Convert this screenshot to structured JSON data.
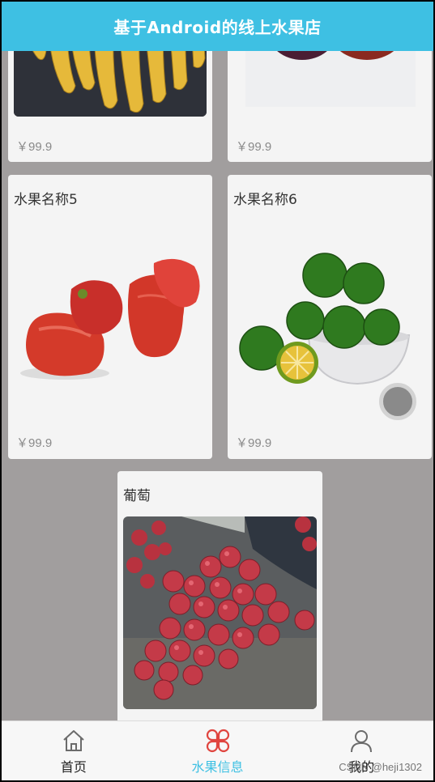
{
  "header": {
    "title": "基于Android的线上水果店"
  },
  "products": [
    {
      "name": "",
      "price": "￥99.9",
      "image": "bananas"
    },
    {
      "name": "",
      "price": "￥99.9",
      "image": "plums"
    },
    {
      "name": "水果名称5",
      "price": "￥99.9",
      "image": "wax-apples"
    },
    {
      "name": "水果名称6",
      "price": "￥99.9",
      "image": "limes"
    },
    {
      "name": "葡萄",
      "price": "",
      "image": "grapes"
    }
  ],
  "tabbar": {
    "tabs": [
      {
        "label": "首页",
        "icon": "home-icon",
        "active": false
      },
      {
        "label": "水果信息",
        "icon": "clover-icon",
        "active": true
      },
      {
        "label": "我的",
        "icon": "user-icon",
        "active": false
      }
    ],
    "active_color": "#3ec0e3"
  },
  "colors": {
    "header_bg": "#3ec0e3",
    "page_bg": "#a19e9e"
  },
  "watermark": "CSDN @heji1302"
}
